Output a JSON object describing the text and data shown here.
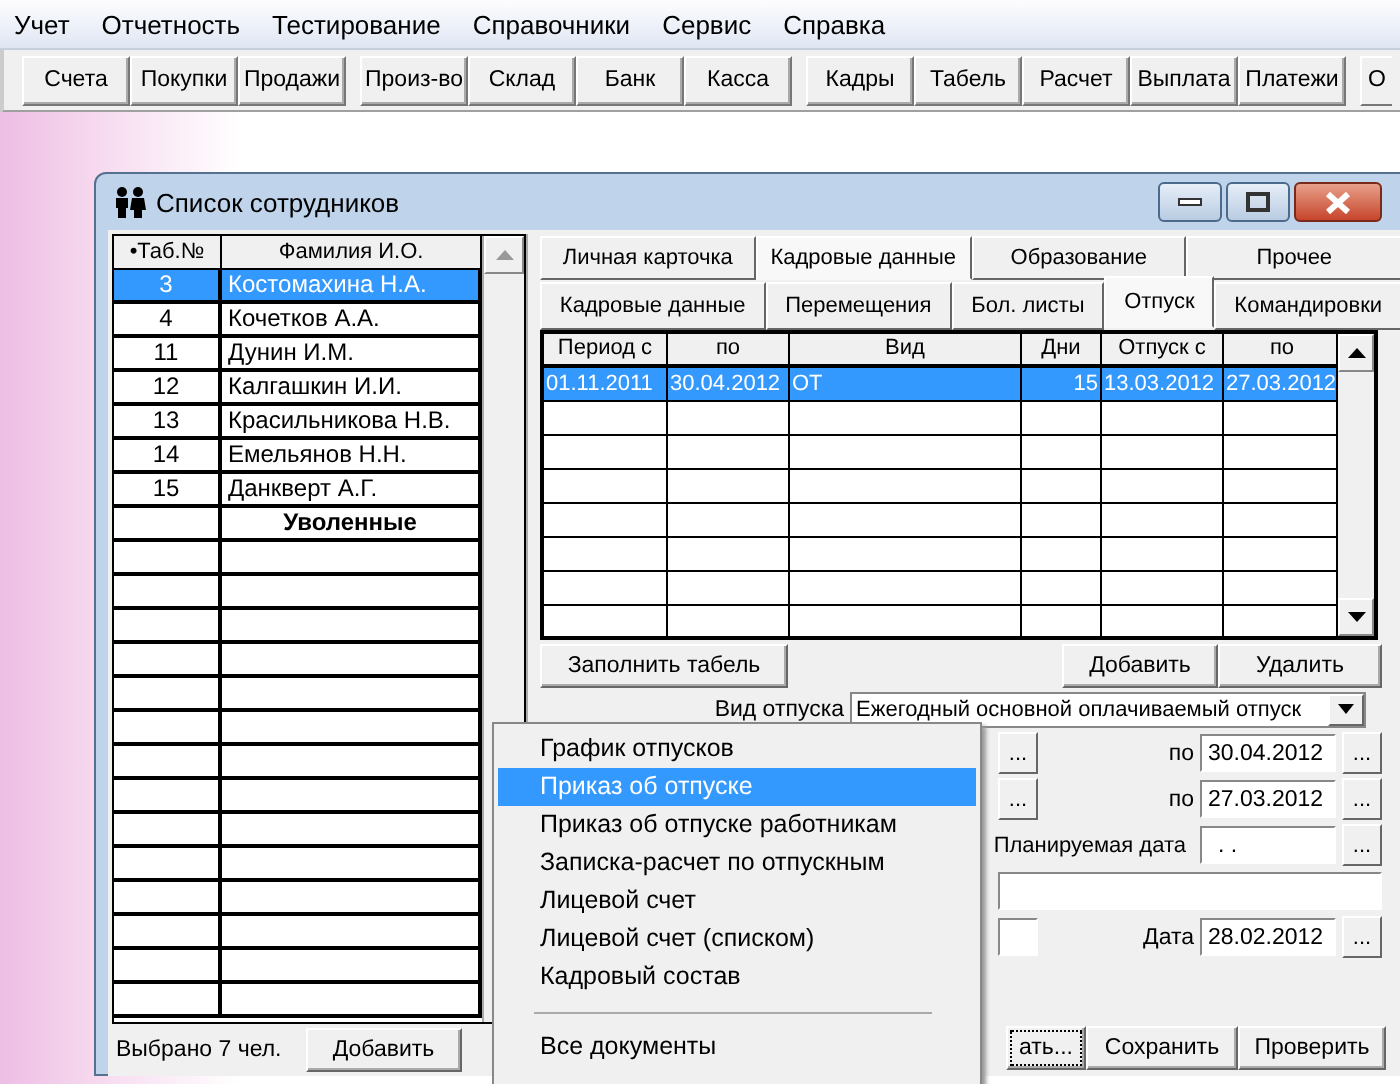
{
  "menu_bar": [
    "Учет",
    "Отчетность",
    "Тестирование",
    "Справочники",
    "Сервис",
    "Справка"
  ],
  "toolbar_groups": [
    [
      "Счета",
      "Покупки",
      "Продажи"
    ],
    [
      "Произ-во",
      "Склад",
      "Банк",
      "Касса"
    ],
    [
      "Кадры",
      "Табель",
      "Расчет",
      "Выплата",
      "Платежи"
    ],
    [
      "О"
    ]
  ],
  "window": {
    "title": "Список сотрудников"
  },
  "employees": {
    "columns": [
      "•Таб.№",
      "Фамилия И.О."
    ],
    "rows": [
      {
        "number": "3",
        "name": "Костомахина Н.А.",
        "selected": true
      },
      {
        "number": "4",
        "name": "Кочетков А.А.",
        "selected": false
      },
      {
        "number": "11",
        "name": "Дунин И.М.",
        "selected": false
      },
      {
        "number": "12",
        "name": "Калгашкин И.И.",
        "selected": false
      },
      {
        "number": "13",
        "name": "Красильникова Н.В.",
        "selected": false
      },
      {
        "number": "14",
        "name": "Емельянов Н.Н.",
        "selected": false
      },
      {
        "number": "15",
        "name": "Данкверт А.Г.",
        "selected": false
      }
    ],
    "section_label": "Уволенные",
    "count": "Выбрано 7 чел.",
    "add_button": "Добавить"
  },
  "tabs": [
    {
      "label": "Личная карточка",
      "selected": false
    },
    {
      "label": "Кадровые данные",
      "selected": true
    },
    {
      "label": "Образование",
      "selected": false
    },
    {
      "label": "Прочее",
      "selected": false
    }
  ],
  "subtabs": [
    {
      "label": "Кадровые данные",
      "selected": false
    },
    {
      "label": "Перемещения",
      "selected": false
    },
    {
      "label": "Бол. листы",
      "selected": false
    },
    {
      "label": "Отпуск",
      "selected": true
    },
    {
      "label": "Командировки",
      "selected": false
    }
  ],
  "vacations": {
    "columns": [
      "Период с",
      "по",
      "Вид",
      "Дни",
      "Отпуск с",
      "по"
    ],
    "rows": [
      {
        "cells": [
          "01.11.2011",
          "30.04.2012",
          "ОТ",
          "15",
          "13.03.2012",
          "27.03.2012"
        ],
        "selected": true
      }
    ]
  },
  "vacation_buttons": [
    "Заполнить табель",
    "Добавить",
    "Удалить"
  ],
  "form": [
    {
      "kind": "combo",
      "label": "Вид отпуска",
      "value": "Ежегодный основной оплачиваемый отпуск"
    },
    {
      "kind": "range",
      "left_button": "...",
      "label": "по",
      "value": "30.04.2012",
      "button": "..."
    },
    {
      "kind": "range",
      "left_button": "...",
      "label": "по",
      "value": "27.03.2012",
      "button": "..."
    },
    {
      "kind": "date",
      "label": "Планируемая дата",
      "value": ". .",
      "button": "..."
    },
    {
      "kind": "blank"
    },
    {
      "kind": "dated",
      "label": "Дата",
      "value": "28.02.2012",
      "button": "..."
    }
  ],
  "bottom_buttons": [
    "ать...",
    "Сохранить",
    "Проверить"
  ],
  "popup_menu": [
    {
      "kind": "item",
      "label": "График отпусков",
      "selected": false
    },
    {
      "kind": "item",
      "label": "Приказ об отпуске",
      "selected": true
    },
    {
      "kind": "item",
      "label": "Приказ об отпуске работникам",
      "selected": false
    },
    {
      "kind": "item",
      "label": "Записка-расчет по отпускным",
      "selected": false
    },
    {
      "kind": "item",
      "label": "Лицевой счет",
      "selected": false
    },
    {
      "kind": "item",
      "label": "Лицевой счет (списком)",
      "selected": false
    },
    {
      "kind": "item",
      "label": "Кадровый состав",
      "selected": false
    },
    {
      "kind": "separator"
    },
    {
      "kind": "item",
      "label": "Все документы",
      "selected": false
    }
  ]
}
